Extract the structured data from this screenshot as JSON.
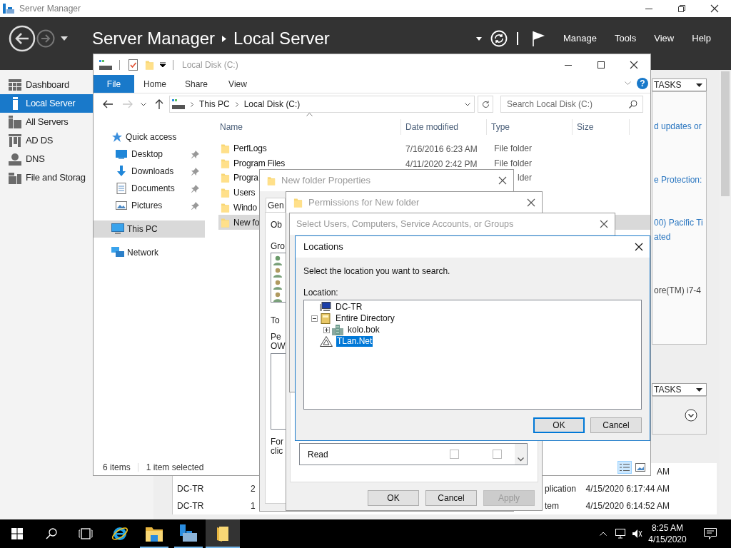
{
  "server_manager": {
    "title": "Server Manager",
    "breadcrumb": [
      "Server Manager",
      "Local Server"
    ],
    "menu": [
      "Manage",
      "Tools",
      "View",
      "Help"
    ],
    "nav": [
      {
        "label": "Dashboard",
        "kind": "dashboard",
        "selected": false
      },
      {
        "label": "Local Server",
        "kind": "local",
        "selected": true
      },
      {
        "label": "All Servers",
        "kind": "all",
        "selected": false
      },
      {
        "label": "AD DS",
        "kind": "adds",
        "selected": false
      },
      {
        "label": "DNS",
        "kind": "dns",
        "selected": false
      },
      {
        "label": "File and Storag",
        "kind": "files",
        "selected": false
      }
    ],
    "properties_panel": {
      "tasks": "TASKS",
      "lines": [
        {
          "text": "d updates or",
          "kind": "link"
        },
        {
          "text": "e Protection:",
          "kind": "link"
        },
        {
          "text": "00) Pacific Ti",
          "kind": "link"
        },
        {
          "text": "ated",
          "kind": "link"
        },
        {
          "text": "ore(TM) i7-4",
          "kind": "text"
        }
      ]
    },
    "events_panel": {
      "tasks": "TASKS",
      "rows": [
        {
          "time": "AM"
        },
        {
          "server": "DC-TR",
          "column_2": "2",
          "source": "plication",
          "time": "4/15/2020 6:17:44 AM"
        },
        {
          "server": "DC-TR",
          "column_2": "1",
          "source": "tem",
          "time": "4/15/2020 6:14:52 AM"
        }
      ]
    }
  },
  "explorer": {
    "title": "Local Disk (C:)",
    "ribbon_tabs": [
      {
        "label": "File",
        "selected": true
      },
      {
        "label": "Home",
        "selected": false
      },
      {
        "label": "Share",
        "selected": false
      },
      {
        "label": "View",
        "selected": false
      }
    ],
    "help": "?",
    "path": [
      "This PC",
      "Local Disk (C:)"
    ],
    "search_placeholder": "Search Local Disk (C:)",
    "nav": [
      {
        "label": "Quick access",
        "kind": "quick",
        "selected": false
      },
      {
        "label": "Desktop",
        "kind": "desktop",
        "pinned": true,
        "selected": false
      },
      {
        "label": "Downloads",
        "kind": "downloads",
        "pinned": true,
        "selected": false
      },
      {
        "label": "Documents",
        "kind": "documents",
        "pinned": true,
        "selected": false
      },
      {
        "label": "Pictures",
        "kind": "pictures",
        "pinned": true,
        "selected": false
      },
      {
        "label": "This PC",
        "kind": "pc",
        "selected": true
      },
      {
        "label": "Network",
        "kind": "network",
        "selected": false
      }
    ],
    "columns": [
      "Name",
      "Date modified",
      "Type",
      "Size"
    ],
    "files": [
      {
        "name": "PerfLogs",
        "date": "7/16/2016 6:23 AM",
        "type": "File folder",
        "selected": false
      },
      {
        "name": "Program Files",
        "date": "4/11/2020 2:42 PM",
        "type": "File folder",
        "selected": false
      },
      {
        "name": "Progra",
        "type": "lder",
        "selected": false
      },
      {
        "name": "Users",
        "selected": false
      },
      {
        "name": "Windo",
        "selected": false
      },
      {
        "name": "New fo",
        "selected": true
      }
    ],
    "status": [
      "6 items",
      "1 item selected"
    ],
    "views": [
      {
        "kind": "details",
        "selected": true
      },
      {
        "kind": "large_icons",
        "selected": false
      }
    ]
  },
  "properties_dialog": {
    "title": "New folder Properties",
    "tab": "Gen",
    "labels": [
      "Ob",
      "Gro",
      "To",
      "Pe",
      "OW",
      "For",
      "clic"
    ]
  },
  "permissions_dialog": {
    "title": "Permissions for New folder",
    "permissions": [
      {
        "name": "Read",
        "allow": false,
        "deny": false
      }
    ],
    "buttons": [
      {
        "label": "OK",
        "disabled": false
      },
      {
        "label": "Cancel",
        "disabled": false
      },
      {
        "label": "Apply",
        "disabled": true
      }
    ]
  },
  "select_dialog": {
    "title": "Select Users, Computers, Service Accounts, or Groups"
  },
  "locations_dialog": {
    "title": "Locations",
    "prompt": "Select the location you want to search.",
    "label": "Location:",
    "tree": [
      {
        "label": "DC-TR",
        "kind": "computer",
        "selected": false
      },
      {
        "label": "Entire Directory",
        "kind": "directory",
        "expanded": true,
        "selected": false,
        "children": [
          {
            "label": "kolo.bok",
            "kind": "domain",
            "expanded": false,
            "selected": false
          }
        ]
      },
      {
        "label": "TLan.Net",
        "kind": "forest",
        "selected": true
      }
    ],
    "buttons": [
      {
        "label": "OK",
        "default": true
      },
      {
        "label": "Cancel",
        "default": false
      }
    ]
  },
  "taskbar": {
    "buttons": [
      {
        "kind": "start"
      },
      {
        "kind": "search"
      },
      {
        "kind": "taskview"
      }
    ],
    "apps": [
      {
        "kind": "browser",
        "running": false,
        "active": false
      },
      {
        "kind": "explorer",
        "running": true,
        "active": false
      },
      {
        "kind": "server_manager",
        "running": true,
        "active": false
      },
      {
        "kind": "folder",
        "running": true,
        "active": true
      }
    ],
    "time": "8:25 AM",
    "date": "4/15/2020"
  }
}
